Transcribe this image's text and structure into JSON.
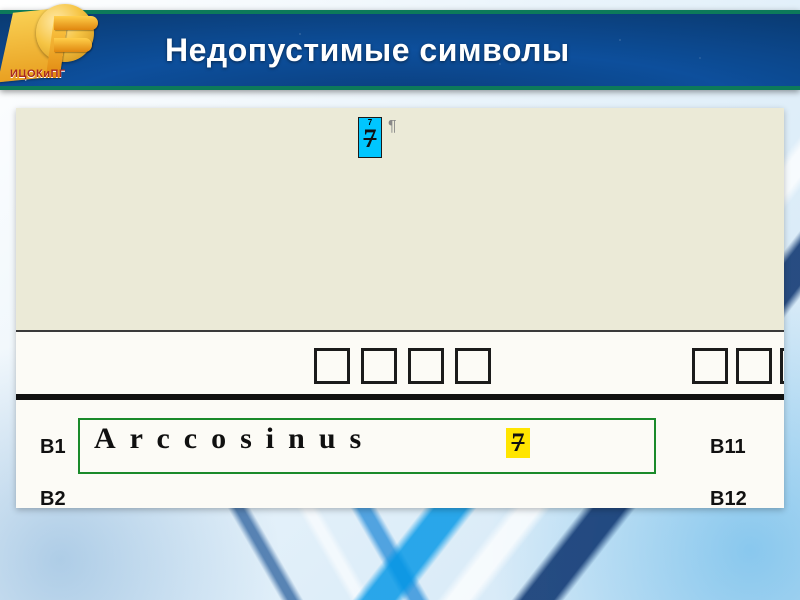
{
  "header": {
    "title": "Недопустимые символы",
    "logo_text": "ИЦОКиПГ"
  },
  "top_highlight": {
    "small": "7",
    "big": "7",
    "pilcrow": "¶"
  },
  "form": {
    "left_labels": [
      "В1",
      "В2"
    ],
    "right_labels": [
      "В11",
      "В12"
    ],
    "answer_b1_chars": [
      "A",
      "r",
      "c",
      "c",
      "o",
      "s",
      "i",
      "n",
      "u",
      "s"
    ],
    "b1_highlight": "7",
    "empty_box_count_left": 4,
    "empty_box_count_right": 3
  }
}
